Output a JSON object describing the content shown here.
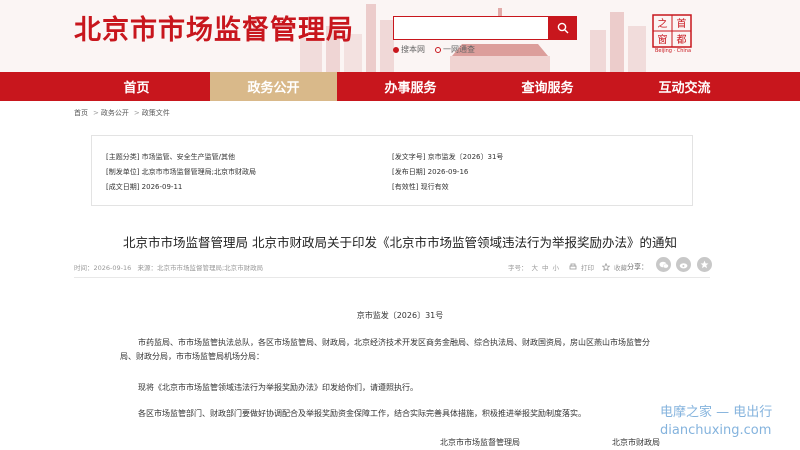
{
  "header": {
    "site_title": "北京市市场监督管理局",
    "search_placeholder": "",
    "search_scope": [
      "搜本网",
      "一网通查"
    ],
    "logo_text": [
      "之",
      "首",
      "窗",
      "都"
    ],
    "logo_caption": "Beijing · China"
  },
  "nav": {
    "items": [
      "首页",
      "政务公开",
      "办事服务",
      "查询服务",
      "互动交流"
    ],
    "active": "政务公开"
  },
  "breadcrumb": [
    "首页",
    "政务公开",
    "政策文件"
  ],
  "meta": {
    "topic": "[主题分类] 市场监管、安全生产监管/其他",
    "doc_number": "[发文字号] 京市监发〔2026〕31号",
    "issuer": "[制发单位] 北京市市场监督管理局;北京市财政局",
    "publish_date": "[发布日期] 2026-09-16",
    "create_date": "[成文日期] 2026-09-11",
    "validity": "[有效性] 现行有效"
  },
  "article": {
    "title": "北京市市场监督管理局 北京市财政局关于印发《北京市市场监管领域违法行为举报奖励办法》的通知",
    "time": "时间：2026-09-16",
    "source": "来源：北京市市场监督管理局;北京市财政局",
    "font_label": "字号：",
    "font_sizes": [
      "大",
      "中",
      "小"
    ],
    "print": "打印",
    "favorite": "收藏",
    "share_label": "分享：",
    "doc_no": "京市监发〔2026〕31号",
    "para1": "市药监局、市市场监管执法总队，各区市场监管局、财政局，北京经济技术开发区商务金融局、综合执法局、财政国资局，房山区燕山市场监管分局、财政分局，市市场监管局机场分局：",
    "para2": "现将《北京市市场监管领域违法行为举报奖励办法》印发给你们，请遵照执行。",
    "para3": "各区市场监管部门、财政部门要做好协调配合及举报奖励资金保障工作，结合实际完善具体措施，积极推进举报奖励制度落实。",
    "sign1": "北京市市场监督管理局",
    "sign2": "北京市财政局"
  },
  "watermark": {
    "line1": "电摩之家 — 电出行",
    "line2": "dianchuxing.com"
  },
  "colors": {
    "brand_red": "#c8161d",
    "nav_active": "#d9b98a",
    "watermark_blue": "#6fa6d8"
  }
}
